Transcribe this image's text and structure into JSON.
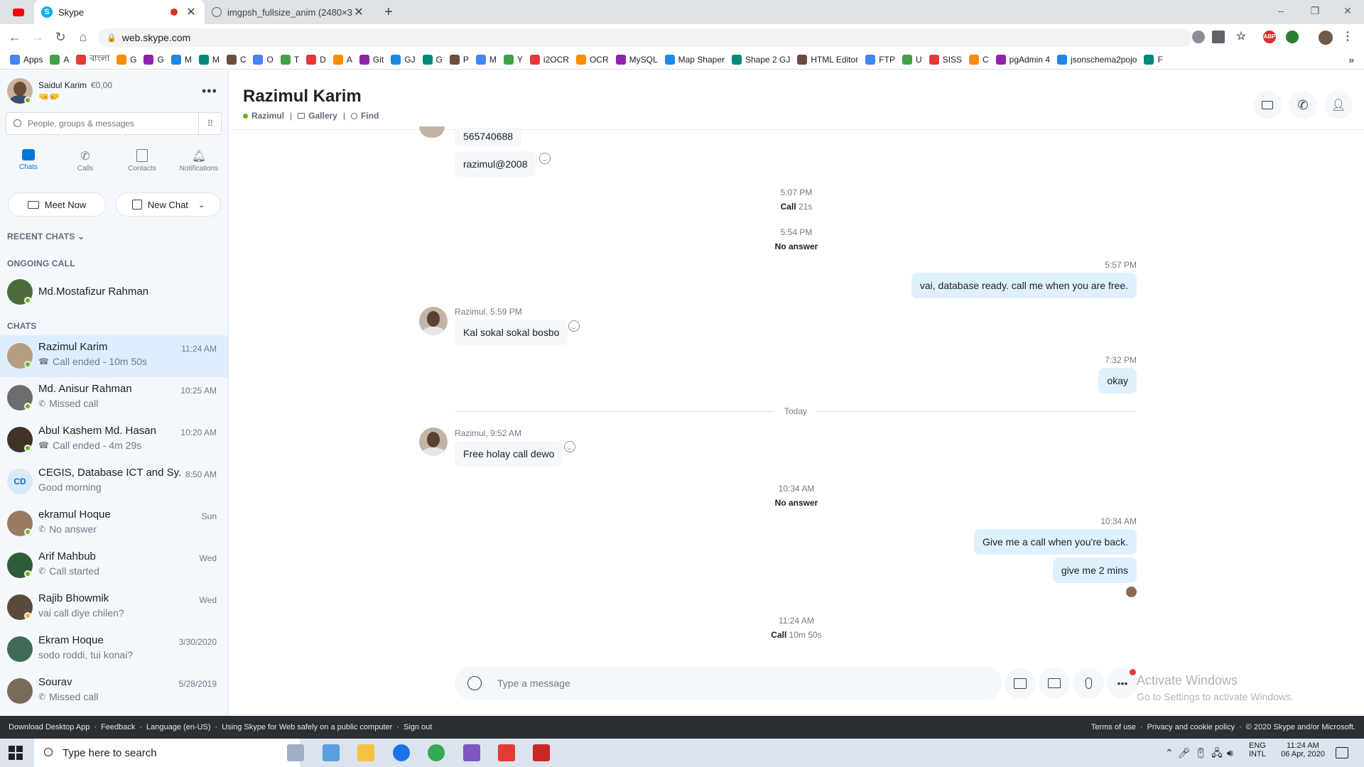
{
  "browser": {
    "tabs": [
      {
        "title": "Skype"
      },
      {
        "title": "imgpsh_fullsize_anim (2480×3508)"
      }
    ],
    "new_tab": "+",
    "url": "web.skype.com",
    "bookmarks": [
      "Apps",
      "A",
      "বাংলা",
      "G",
      "G",
      "M",
      "M",
      "C",
      "O",
      "T",
      "D",
      "A",
      "Git",
      "GJ",
      "G",
      "P",
      "M",
      "Y",
      "i2OCR",
      "OCR",
      "MySQL",
      "Map Shaper",
      "Shape 2 GJ",
      "HTML Editor",
      "FTP",
      "U",
      "SISS",
      "C",
      "pgAdmin 4",
      "jsonschema2pojo",
      "F"
    ],
    "ext_abp": "ABP"
  },
  "profile": {
    "name": "Saidul Karim",
    "credit": "€0,00",
    "status_emoji": "🤜🤛"
  },
  "search": {
    "placeholder": "People, groups & messages"
  },
  "nav": {
    "chats": "Chats",
    "calls": "Calls",
    "contacts": "Contacts",
    "notifications": "Notifications"
  },
  "buttons": {
    "meet_now": "Meet Now",
    "new_chat": "New Chat"
  },
  "sections": {
    "recent": "RECENT CHATS",
    "ongoing": "ONGOING CALL",
    "chats": "CHATS"
  },
  "ongoing": {
    "name": "Md.Mostafizur Rahman"
  },
  "chats": [
    {
      "name": "Razimul Karim",
      "sub": "Call ended - 10m 50s",
      "time": "11:24 AM",
      "icon": "call-ended-icon"
    },
    {
      "name": "Md. Anisur Rahman",
      "sub": "Missed call",
      "time": "10:25 AM",
      "icon": "missed-call-icon"
    },
    {
      "name": "Abul Kashem Md. Hasan",
      "sub": "Call ended - 4m 29s",
      "time": "10:20 AM",
      "icon": "call-ended-icon"
    },
    {
      "name": "CEGIS, Database ICT and Sy...",
      "sub": "Good morning",
      "time": "8:50 AM",
      "initials": "CD"
    },
    {
      "name": "ekramul Hoque",
      "sub": "No answer",
      "time": "Sun",
      "icon": "missed-call-icon"
    },
    {
      "name": "Arif Mahbub",
      "sub": "Call started",
      "time": "Wed",
      "icon": "phone-icon"
    },
    {
      "name": "Rajib Bhowmik",
      "sub": "vai call diye chilen?",
      "time": "Wed"
    },
    {
      "name": "Ekram Hoque",
      "sub": "sodo roddi, tui konai?",
      "time": "3/30/2020"
    },
    {
      "name": "Sourav",
      "sub": "Missed call",
      "time": "5/28/2019",
      "icon": "missed-call-icon"
    }
  ],
  "conversation": {
    "title": "Razimul Karim",
    "status_name": "Razimul",
    "gallery": "Gallery",
    "find": "Find",
    "sep": "|",
    "messages": {
      "m0": "565740688",
      "m1": "razimul@2008",
      "e1_time": "5:07 PM",
      "e1_label": "Call",
      "e1_dur": "21s",
      "e2_time": "5:54 PM",
      "e2_label": "No answer",
      "m2_time": "5:57 PM",
      "m2": "vai, database ready. call me when you are free.",
      "m3_meta": "Razimul, 5:59 PM",
      "m3": "Kal sokal sokal bosbo",
      "m4_time": "7:32 PM",
      "m4": "okay",
      "divider": "Today",
      "m5_meta": "Razimul, 9:52 AM",
      "m5": "Free holay call dewo",
      "e3_time": "10:34 AM",
      "e3_label": "No answer",
      "m6_time": "10:34 AM",
      "m6": "Give me a call when you're back.",
      "m7": "give me 2 mins",
      "e4_time": "11:24 AM",
      "e4_label": "Call",
      "e4_dur": "10m 50s"
    }
  },
  "composer": {
    "placeholder": "Type a message"
  },
  "watermark": {
    "line1": "Activate Windows",
    "line2": "Go to Settings to activate Windows."
  },
  "footer": {
    "left": [
      "Download Desktop App",
      "·",
      "Feedback",
      "·",
      "Language (en-US)",
      "·",
      "Using Skype for Web safely on a public computer",
      "·",
      "Sign out"
    ],
    "right": [
      "Terms of use",
      "·",
      "Privacy and cookie policy",
      "·",
      "© 2020 Skype and/or Microsoft."
    ]
  },
  "taskbar": {
    "search": "Type here to search",
    "lang1": "ENG",
    "lang2": "INTL",
    "time": "11:24 AM",
    "date": "06 Apr, 2020"
  }
}
